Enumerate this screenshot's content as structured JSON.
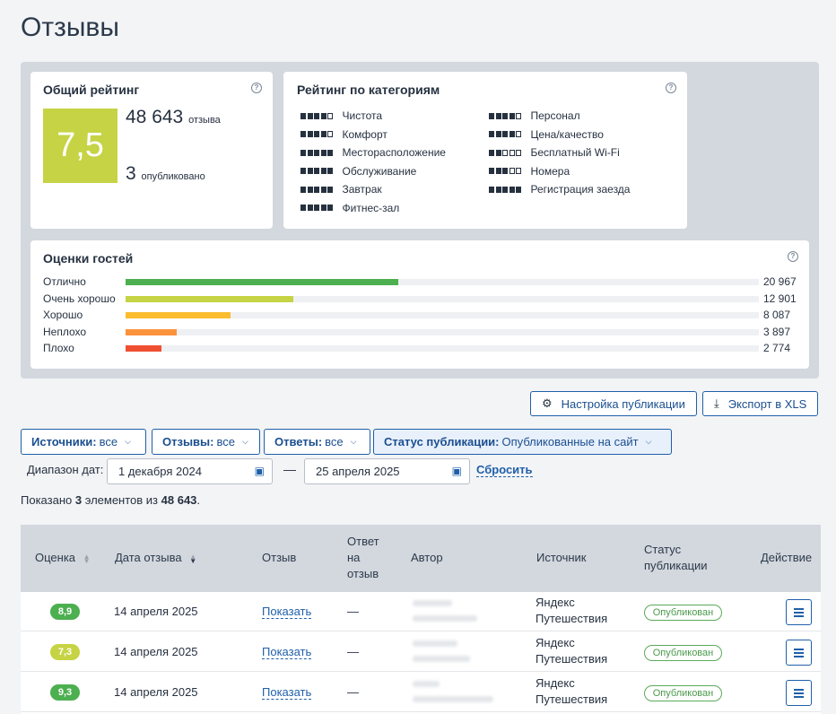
{
  "page": {
    "title": "Отзывы"
  },
  "overall": {
    "title": "Общий рейтинг",
    "score": "7,5",
    "score_color": "#c6d344",
    "reviews_count": "48 643",
    "reviews_label": "отзыва",
    "published_count": "3",
    "published_label": "опубликовано"
  },
  "categories": {
    "title": "Рейтинг по категориям",
    "items": [
      {
        "label": "Чистота",
        "filled": 4
      },
      {
        "label": "Персонал",
        "filled": 4
      },
      {
        "label": "Комфорт",
        "filled": 4
      },
      {
        "label": "Цена/качество",
        "filled": 4
      },
      {
        "label": "Месторасположение",
        "filled": 5
      },
      {
        "label": "Бесплатный Wi-Fi",
        "filled": 2
      },
      {
        "label": "Обслуживание",
        "filled": 5
      },
      {
        "label": "Номера",
        "filled": 3
      },
      {
        "label": "Завтрак",
        "filled": 5
      },
      {
        "label": "Регистрация заезда",
        "filled": 5
      },
      {
        "label": "Фитнес-зал",
        "filled": 5
      }
    ]
  },
  "guest_ratings": {
    "title": "Оценки гостей",
    "rows": [
      {
        "label": "Отлично",
        "count": "20 967",
        "value": 20967,
        "color": "#4caf50"
      },
      {
        "label": "Очень хорошо",
        "count": "12 901",
        "value": 12901,
        "color": "#c6d344"
      },
      {
        "label": "Хорошо",
        "count": "8 087",
        "value": 8087,
        "color": "#fbbc2e"
      },
      {
        "label": "Неплохо",
        "count": "3 897",
        "value": 3897,
        "color": "#fb923c"
      },
      {
        "label": "Плохо",
        "count": "2 774",
        "value": 2774,
        "color": "#f05032"
      }
    ],
    "max": 48643
  },
  "toolbar": {
    "settings_label": "Настройка публикации",
    "export_label": "Экспорт в XLS"
  },
  "filters": {
    "sources": {
      "key": "Источники:",
      "value": "все"
    },
    "reviews": {
      "key": "Отзывы:",
      "value": "все"
    },
    "answers": {
      "key": "Ответы:",
      "value": "все"
    },
    "status": {
      "key": "Статус публикации:",
      "value": "Опубликованные на сайт"
    }
  },
  "date_range": {
    "label": "Диапазон дат:",
    "from": "1 декабря 2024",
    "to": "25 апреля 2025",
    "separator": "—",
    "reset": "Сбросить"
  },
  "summary": {
    "prefix": "Показано",
    "shown": "3",
    "middle": "элементов из",
    "total": "48 643",
    "suffix": "."
  },
  "table": {
    "headers": {
      "rating": "Оценка",
      "date": "Дата отзыва",
      "review": "Отзыв",
      "answer_l1": "Ответ",
      "answer_l2": "на",
      "answer_l3": "отзыв",
      "author": "Автор",
      "source": "Источник",
      "status_l1": "Статус",
      "status_l2": "публикации",
      "action": "Действие"
    },
    "rows": [
      {
        "rating": "8,9",
        "rating_color": "#4caf50",
        "date": "14 апреля 2025",
        "review": "Показать",
        "answer": "—",
        "source_l1": "Яндекс",
        "source_l2": "Путешествия",
        "status": "Опубликован"
      },
      {
        "rating": "7,3",
        "rating_color": "#c6d344",
        "date": "14 апреля 2025",
        "review": "Показать",
        "answer": "—",
        "source_l1": "Яндекс",
        "source_l2": "Путешествия",
        "status": "Опубликован"
      },
      {
        "rating": "9,3",
        "rating_color": "#4caf50",
        "date": "14 апреля 2025",
        "review": "Показать",
        "answer": "—",
        "source_l1": "Яндекс",
        "source_l2": "Путешествия",
        "status": "Опубликован"
      }
    ]
  }
}
